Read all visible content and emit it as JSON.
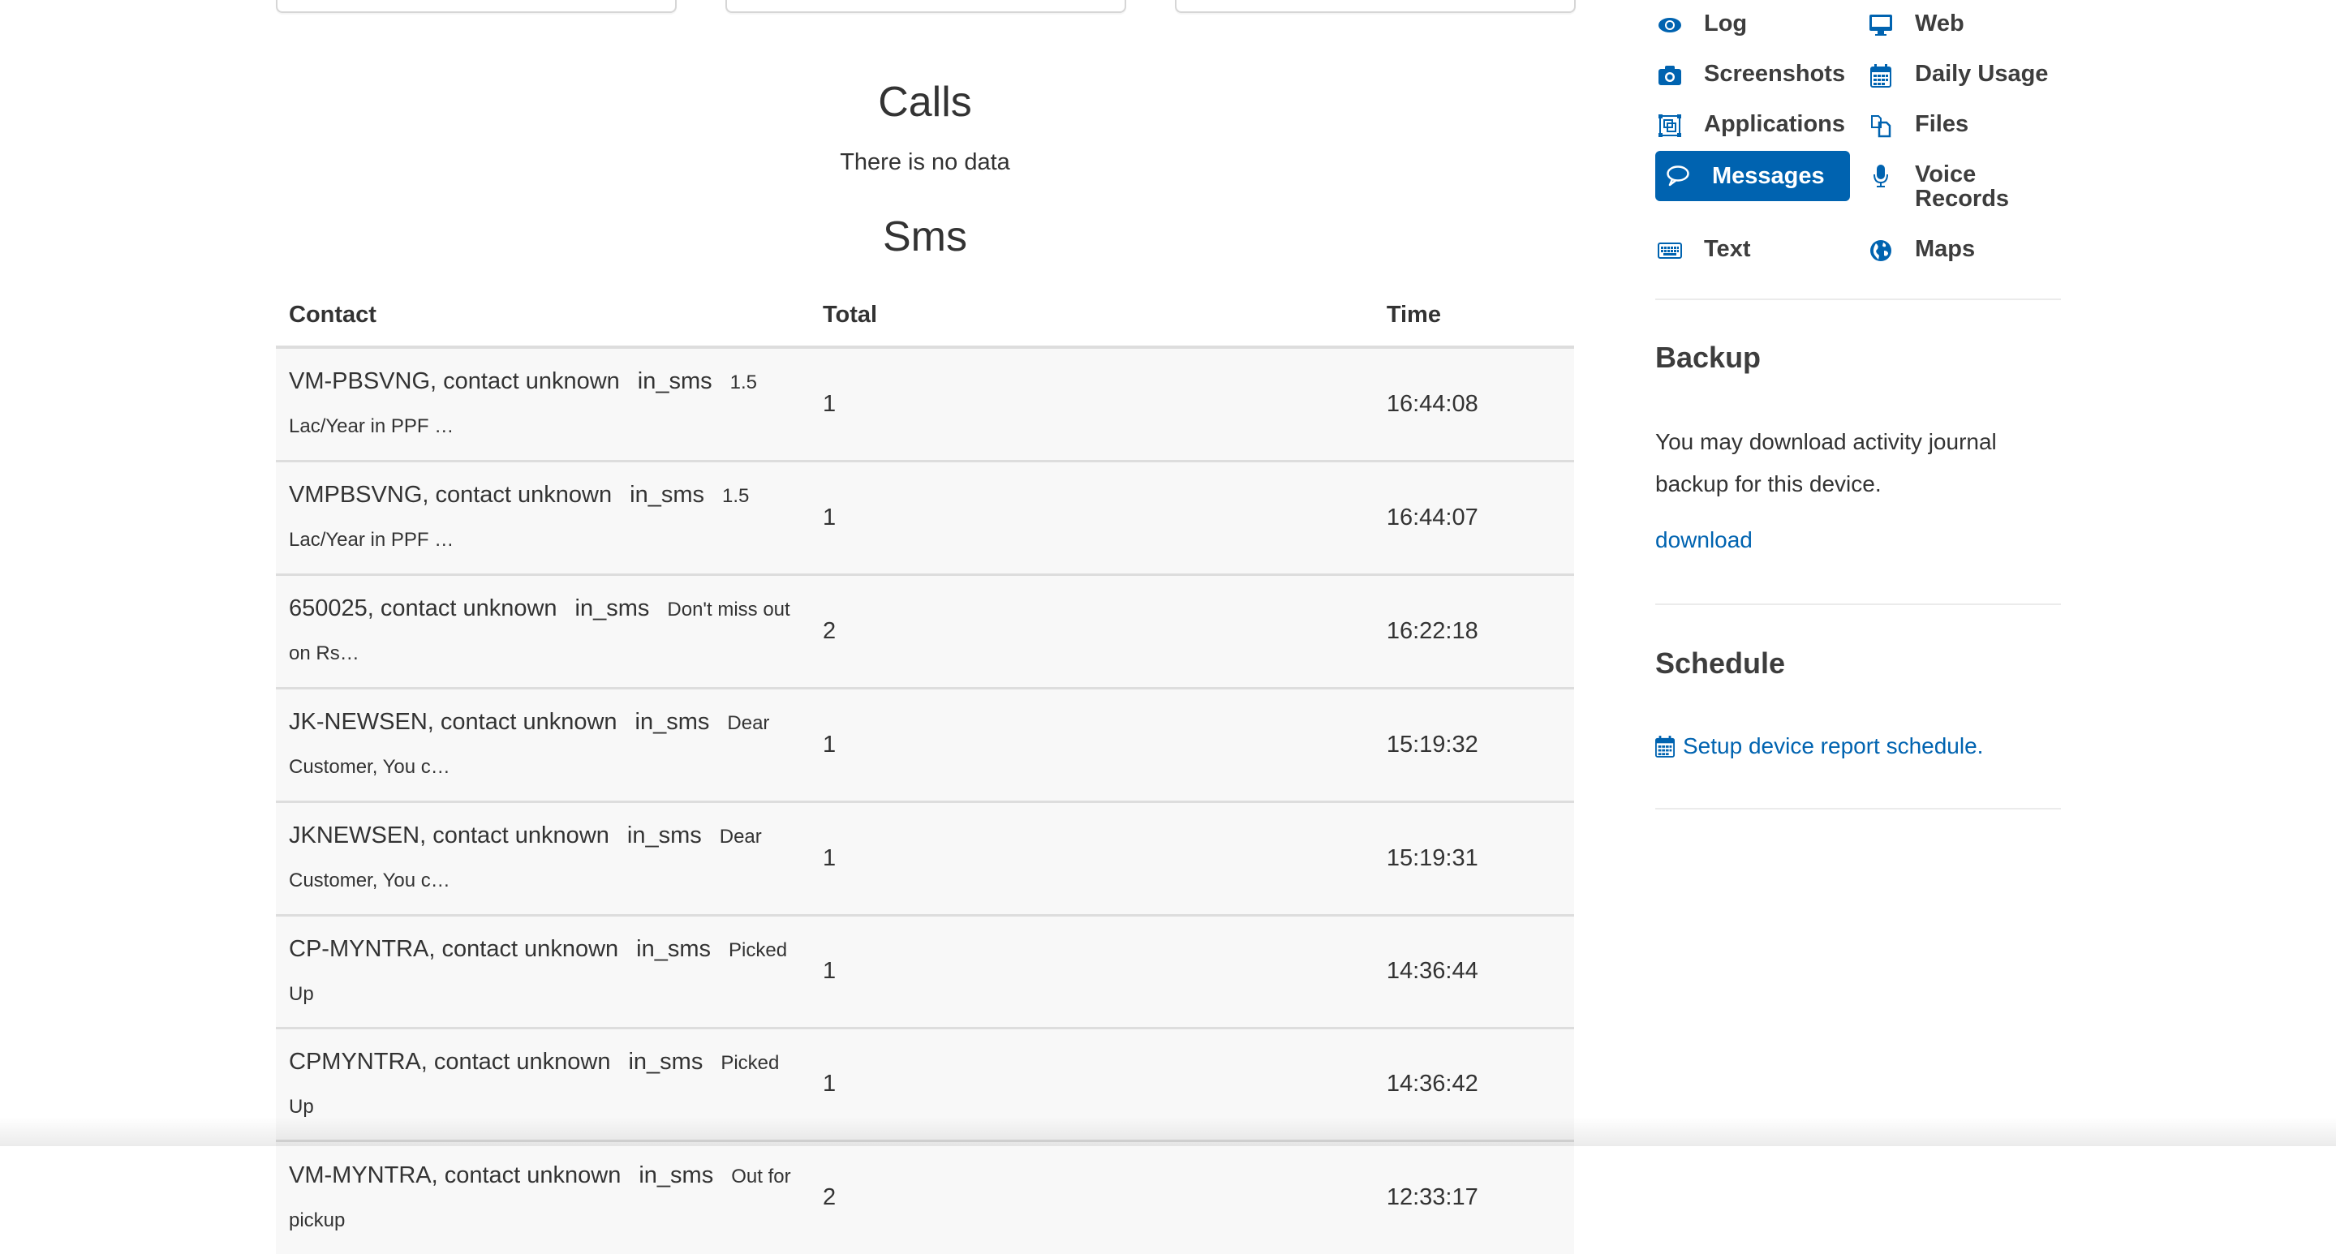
{
  "calls": {
    "title": "Calls",
    "empty_message": "There is no data"
  },
  "sms": {
    "title": "Sms",
    "columns": [
      "Contact",
      "Total",
      "Time"
    ],
    "rows": [
      {
        "contact": "VM-PBSVNG, contact unknown",
        "type": "in_sms",
        "snippet": "1.5 Lac/Year in PPF …",
        "total": "1",
        "time": "16:44:08"
      },
      {
        "contact": "VMPBSVNG, contact unknown",
        "type": "in_sms",
        "snippet": "1.5 Lac/Year in PPF …",
        "total": "1",
        "time": "16:44:07"
      },
      {
        "contact": "650025, contact unknown",
        "type": "in_sms",
        "snippet": "Don't miss out on Rs…",
        "total": "2",
        "time": "16:22:18"
      },
      {
        "contact": "JK-NEWSEN, contact unknown",
        "type": "in_sms",
        "snippet": "Dear Customer, You c…",
        "total": "1",
        "time": "15:19:32"
      },
      {
        "contact": "JKNEWSEN, contact unknown",
        "type": "in_sms",
        "snippet": "Dear Customer, You c…",
        "total": "1",
        "time": "15:19:31"
      },
      {
        "contact": "CP-MYNTRA, contact unknown",
        "type": "in_sms",
        "snippet": "Picked Up",
        "total": "1",
        "time": "14:36:44"
      },
      {
        "contact": "CPMYNTRA, contact unknown",
        "type": "in_sms",
        "snippet": "Picked Up",
        "total": "1",
        "time": "14:36:42"
      },
      {
        "contact": "VM-MYNTRA, contact unknown",
        "type": "in_sms",
        "snippet": "Out for pickup",
        "total": "2",
        "time": "12:33:17"
      }
    ]
  },
  "nav": {
    "items": [
      {
        "label": "Log",
        "icon": "eye-icon"
      },
      {
        "label": "Web",
        "icon": "monitor-icon"
      },
      {
        "label": "Screenshots",
        "icon": "camera-icon"
      },
      {
        "label": "Daily Usage",
        "icon": "calendar-icon"
      },
      {
        "label": "Applications",
        "icon": "applications-icon"
      },
      {
        "label": "Files",
        "icon": "files-icon"
      },
      {
        "label": "Messages",
        "icon": "speech-bubble-icon",
        "active": true
      },
      {
        "label": "Voice Records",
        "icon": "microphone-icon"
      },
      {
        "label": "Text",
        "icon": "keyboard-icon"
      },
      {
        "label": "Maps",
        "icon": "globe-icon"
      }
    ],
    "accent_color": "#0063b0"
  },
  "backup": {
    "title": "Backup",
    "description": "You may download activity journal backup for this device.",
    "link_label": "download"
  },
  "schedule": {
    "title": "Schedule",
    "link_label": "Setup device report schedule."
  }
}
